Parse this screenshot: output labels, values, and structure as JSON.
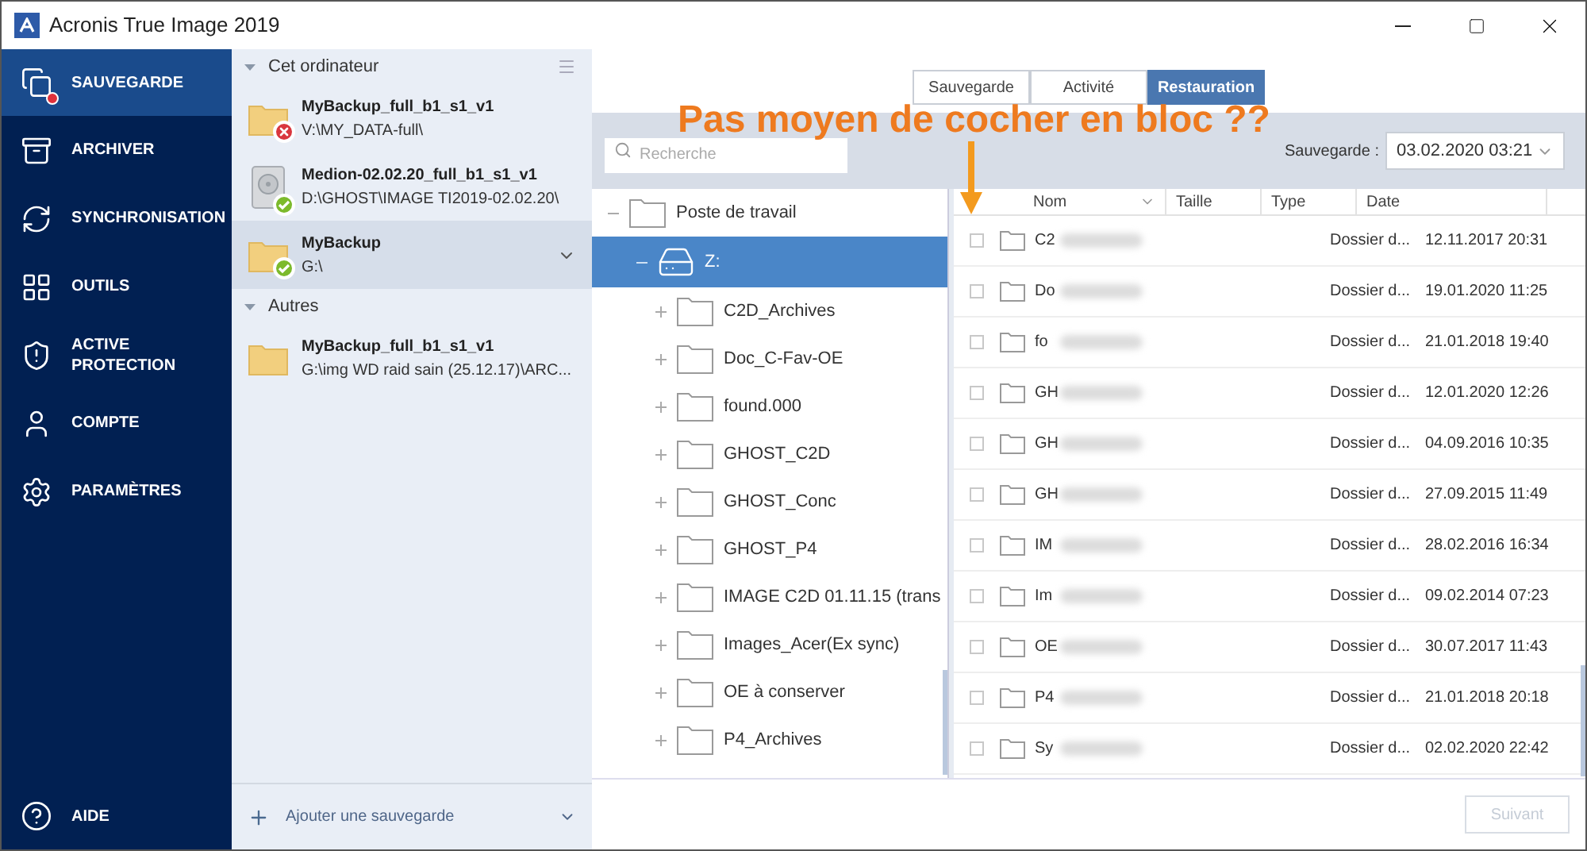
{
  "window": {
    "title": "Acronis True Image 2019"
  },
  "sidebar": {
    "items": [
      {
        "label": "SAUVEGARDE",
        "selected": true,
        "alert": true
      },
      {
        "label": "ARCHIVER",
        "selected": false,
        "alert": false
      },
      {
        "label": "SYNCHRONISATION",
        "selected": false,
        "alert": false
      },
      {
        "label": "OUTILS",
        "selected": false,
        "alert": false
      },
      {
        "label": "ACTIVE PROTECTION",
        "selected": false,
        "alert": false
      },
      {
        "label": "COMPTE",
        "selected": false,
        "alert": false
      },
      {
        "label": "PARAMÈTRES",
        "selected": false,
        "alert": false
      }
    ],
    "help": {
      "label": "AIDE"
    }
  },
  "backups": {
    "groups": [
      {
        "title": "Cet ordinateur",
        "expanded": true,
        "items": [
          {
            "name": "MyBackup_full_b1_s1_v1",
            "path": "V:\\MY_DATA-full\\",
            "kind": "folder",
            "error": true,
            "success": false,
            "selected": false
          },
          {
            "name": "Medion-02.02.20_full_b1_s1_v1",
            "path": "D:\\GHOST\\IMAGE TI2019-02.02.20\\",
            "kind": "disk",
            "error": false,
            "success": true,
            "selected": false
          },
          {
            "name": "MyBackup",
            "path": "G:\\",
            "kind": "folder",
            "error": false,
            "success": true,
            "selected": true
          }
        ]
      },
      {
        "title": "Autres",
        "expanded": true,
        "items": [
          {
            "name": "MyBackup_full_b1_s1_v1",
            "path": "G:\\img WD raid sain (25.12.17)\\ARC...",
            "kind": "folder",
            "error": false,
            "success": false,
            "selected": false
          }
        ]
      }
    ],
    "add_label": "Ajouter une sauvegarde"
  },
  "tabs": [
    {
      "label": "Sauvegarde",
      "selected": false
    },
    {
      "label": "Activité",
      "selected": false
    },
    {
      "label": "Restauration",
      "selected": true
    }
  ],
  "search": {
    "placeholder": "Recherche"
  },
  "version": {
    "label": "Sauvegarde :",
    "value": "03.02.2020 03:21"
  },
  "tree": [
    {
      "label": "Poste de travail",
      "kind": "computer",
      "expanded": true,
      "selected": false,
      "children": [
        {
          "label": "Z:",
          "kind": "drive",
          "expanded": true,
          "selected": true,
          "children": [
            {
              "label": "C2D_Archives",
              "kind": "folder",
              "expanded": false,
              "selected": false
            },
            {
              "label": "Doc_C-Fav-OE",
              "kind": "folder",
              "expanded": false,
              "selected": false
            },
            {
              "label": "found.000",
              "kind": "folder",
              "expanded": false,
              "selected": false
            },
            {
              "label": "GHOST_C2D",
              "kind": "folder",
              "expanded": false,
              "selected": false
            },
            {
              "label": "GHOST_Conc",
              "kind": "folder",
              "expanded": false,
              "selected": false
            },
            {
              "label": "GHOST_P4",
              "kind": "folder",
              "expanded": false,
              "selected": false
            },
            {
              "label": "IMAGE C2D 01.11.15 (trans",
              "kind": "folder",
              "expanded": false,
              "selected": false
            },
            {
              "label": "Images_Acer(Ex sync)",
              "kind": "folder",
              "expanded": false,
              "selected": false
            },
            {
              "label": "OE à conserver",
              "kind": "folder",
              "expanded": false,
              "selected": false
            },
            {
              "label": "P4_Archives",
              "kind": "folder",
              "expanded": false,
              "selected": false
            }
          ]
        }
      ]
    }
  ],
  "table": {
    "columns": [
      "Nom",
      "Taille",
      "Type",
      "Date"
    ],
    "rows": [
      {
        "name": "C2",
        "type": "Dossier d...",
        "date": "12.11.2017 20:31",
        "checked": false
      },
      {
        "name": "Do",
        "type": "Dossier d...",
        "date": "19.01.2020 11:25",
        "checked": false
      },
      {
        "name": "fo",
        "type": "Dossier d...",
        "date": "21.01.2018 19:40",
        "checked": false
      },
      {
        "name": "GH",
        "type": "Dossier d...",
        "date": "12.01.2020 12:26",
        "checked": false
      },
      {
        "name": "GH",
        "type": "Dossier d...",
        "date": "04.09.2016 10:35",
        "checked": false
      },
      {
        "name": "GH",
        "type": "Dossier d...",
        "date": "27.09.2015 11:49",
        "checked": false
      },
      {
        "name": "IM",
        "type": "Dossier d...",
        "date": "28.02.2016 16:34",
        "checked": false
      },
      {
        "name": "Im",
        "type": "Dossier d...",
        "date": "09.02.2014 07:23",
        "checked": false
      },
      {
        "name": "OE",
        "type": "Dossier d...",
        "date": "30.07.2017 11:43",
        "checked": false
      },
      {
        "name": "P4",
        "type": "Dossier d...",
        "date": "21.01.2018 20:18",
        "checked": false
      },
      {
        "name": "Sy",
        "type": "Dossier d...",
        "date": "02.02.2020 22:42",
        "checked": false
      }
    ]
  },
  "next_button": {
    "label": "Suivant",
    "disabled": true
  },
  "annotation": {
    "text": "Pas moyen de cocher en bloc ??"
  }
}
